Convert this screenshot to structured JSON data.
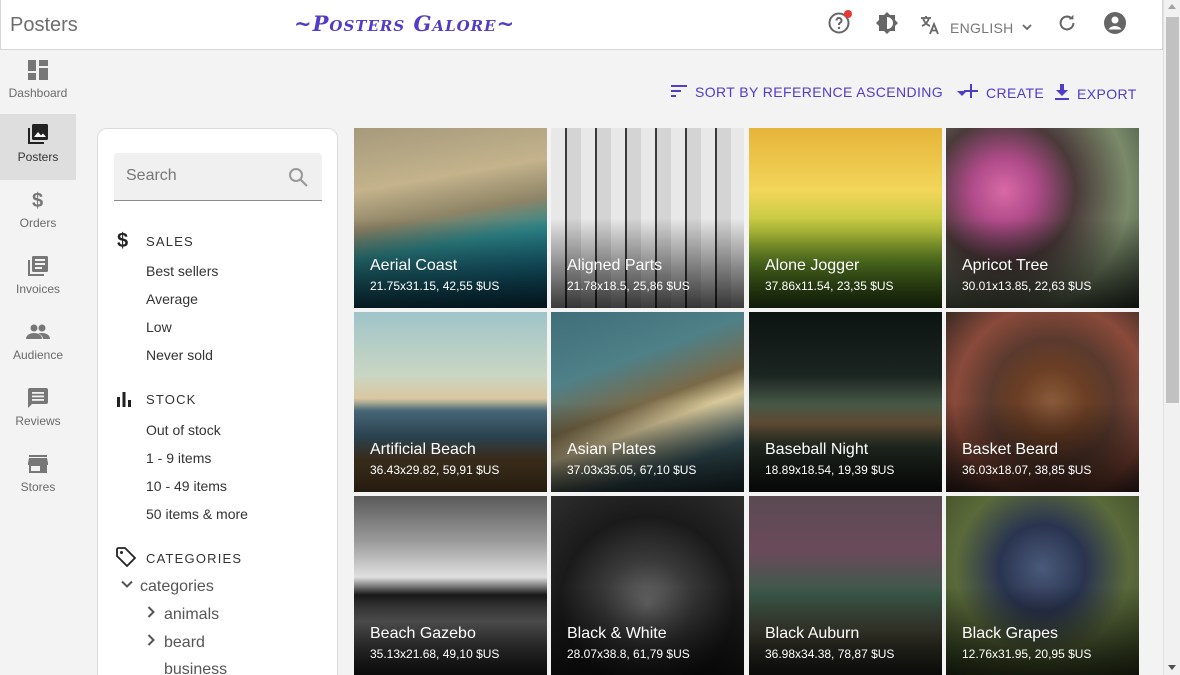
{
  "appbar": {
    "title": "Posters",
    "brand": "~Posters Galore~",
    "language": "ENGLISH",
    "icons": [
      "help-icon",
      "theme-icon",
      "translate-icon",
      "refresh-icon",
      "account-icon"
    ]
  },
  "sidebar": {
    "items": [
      {
        "label": "Dashboard",
        "icon": "dashboard-icon"
      },
      {
        "label": "Posters",
        "icon": "poster-icon"
      },
      {
        "label": "Orders",
        "icon": "dollar-icon"
      },
      {
        "label": "Invoices",
        "icon": "invoices-icon"
      },
      {
        "label": "Audience",
        "icon": "people-icon"
      },
      {
        "label": "Reviews",
        "icon": "comment-icon"
      },
      {
        "label": "Stores",
        "icon": "store-icon"
      }
    ],
    "active": "Posters"
  },
  "toolbar": {
    "sort_label": "SORT BY REFERENCE ASCENDING",
    "create_label": "CREATE",
    "export_label": "EXPORT"
  },
  "filter": {
    "search_placeholder": "Search",
    "sales": {
      "title": "SALES",
      "items": [
        "Best sellers",
        "Average",
        "Low",
        "Never sold"
      ]
    },
    "stock": {
      "title": "STOCK",
      "items": [
        "Out of stock",
        "1 - 9 items",
        "10 - 49 items",
        "50 items & more"
      ]
    },
    "categories": {
      "title": "CATEGORIES",
      "root": "categories",
      "children": [
        "animals",
        "beard",
        "business"
      ]
    }
  },
  "posters": [
    {
      "name": "Aerial Coast",
      "meta": "21.75x31.15, 42,55 $US"
    },
    {
      "name": "Aligned Parts",
      "meta": "21.78x18.5, 25,86 $US"
    },
    {
      "name": "Alone Jogger",
      "meta": "37.86x11.54, 23,35 $US"
    },
    {
      "name": "Apricot Tree",
      "meta": "30.01x13.85, 22,63 $US"
    },
    {
      "name": "Artificial Beach",
      "meta": "36.43x29.82, 59,91 $US"
    },
    {
      "name": "Asian Plates",
      "meta": "37.03x35.05, 67,10 $US"
    },
    {
      "name": "Baseball Night",
      "meta": "18.89x18.54, 19,39 $US"
    },
    {
      "name": "Basket Beard",
      "meta": "36.03x18.07, 38,85 $US"
    },
    {
      "name": "Beach Gazebo",
      "meta": "35.13x21.68, 49,10 $US"
    },
    {
      "name": "Black & White",
      "meta": "28.07x38.8, 61,79 $US"
    },
    {
      "name": "Black Auburn",
      "meta": "36.98x34.38, 78,87 $US"
    },
    {
      "name": "Black Grapes",
      "meta": "12.76x31.95, 20,95 $US"
    }
  ],
  "colors": {
    "accent": "#4f3cc9",
    "sidebar_active": "#dedede",
    "notification": "#e53935"
  }
}
